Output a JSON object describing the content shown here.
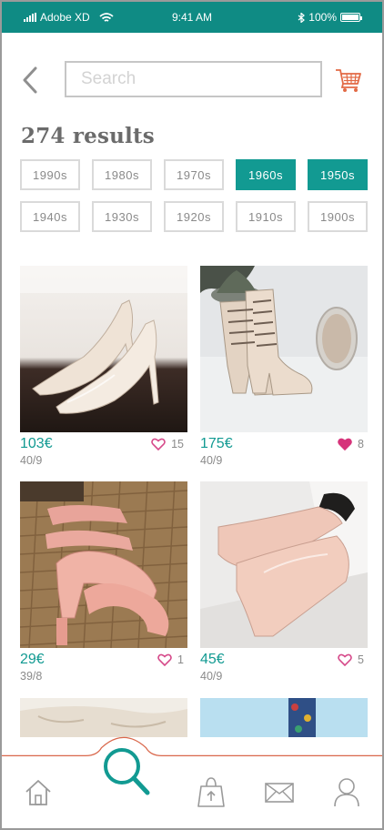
{
  "status_bar": {
    "carrier": "Adobe XD",
    "time": "9:41 AM",
    "battery": "100%"
  },
  "header": {
    "search_placeholder": "Search"
  },
  "results_label": "274 results",
  "decades": [
    {
      "label": "1990s",
      "active": false
    },
    {
      "label": "1980s",
      "active": false
    },
    {
      "label": "1970s",
      "active": false
    },
    {
      "label": "1960s",
      "active": true
    },
    {
      "label": "1950s",
      "active": true
    },
    {
      "label": "1940s",
      "active": false
    },
    {
      "label": "1930s",
      "active": false
    },
    {
      "label": "1920s",
      "active": false
    },
    {
      "label": "1910s",
      "active": false
    },
    {
      "label": "1900s",
      "active": false
    }
  ],
  "products": [
    {
      "price": "103€",
      "size": "40/9",
      "likes": "15",
      "liked": false
    },
    {
      "price": "175€",
      "size": "40/9",
      "likes": "8",
      "liked": true
    },
    {
      "price": "29€",
      "size": "39/8",
      "likes": "1",
      "liked": false
    },
    {
      "price": "45€",
      "size": "40/9",
      "likes": "5",
      "liked": false
    }
  ],
  "colors": {
    "accent": "#129a92",
    "status_bar": "#0f8b84",
    "tab_curve": "#d9674b",
    "heart_outline": "#d64a8a",
    "heart_filled": "#d6337a",
    "cart": "#e26a45"
  },
  "icons": {
    "back": "chevron-left-icon",
    "cart": "shopping-cart-icon",
    "home": "home-icon",
    "search": "magnifier-icon",
    "sell": "shopping-bag-icon",
    "messages": "envelope-icon",
    "profile": "user-icon"
  }
}
